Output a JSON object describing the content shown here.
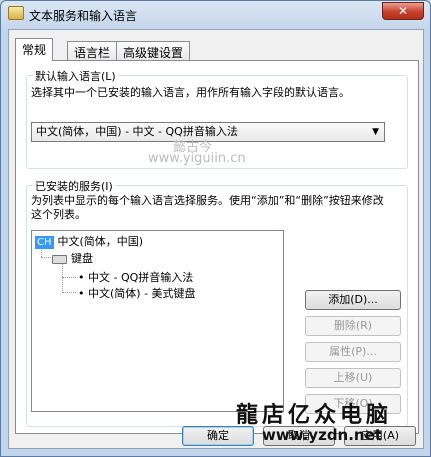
{
  "window": {
    "title": "文本服务和输入语言",
    "close_glyph": "✕"
  },
  "tabs": [
    {
      "label": "常规",
      "active": true
    },
    {
      "label": "语言栏",
      "active": false
    },
    {
      "label": "高级键设置",
      "active": false
    }
  ],
  "default_lang": {
    "group_label": "默认输入语言(L)",
    "description": "选择其中一个已安装的输入语言，用作所有输入字段的默认语言。",
    "selected": "中文(简体，中国) - 中文 - QQ拼音输入法"
  },
  "installed": {
    "group_label": "已安装的服务(I)",
    "description": "为列表中显示的每个输入语言选择服务。使用“添加”和“删除”按钮来修改这个列表。",
    "tree": {
      "lang_badge": "CH",
      "lang_label": "中文(简体，中国)",
      "keyboard_label": "键盘",
      "services": [
        "中文 - QQ拼音输入法",
        "中文(简体) - 美式键盘"
      ]
    },
    "buttons": {
      "add": "添加(D)...",
      "remove": "删除(R)",
      "properties": "属性(P)...",
      "move_up": "上移(U)",
      "move_down": "下移(O)"
    }
  },
  "footer": {
    "ok": "确定",
    "cancel": "取消",
    "apply": "应用(A)"
  },
  "watermarks": {
    "top_name": "懿古今",
    "top_url": "www.yiguiin.cn",
    "brand": "龍店亿众电脑",
    "brand_url": "www.yzdn.net"
  }
}
